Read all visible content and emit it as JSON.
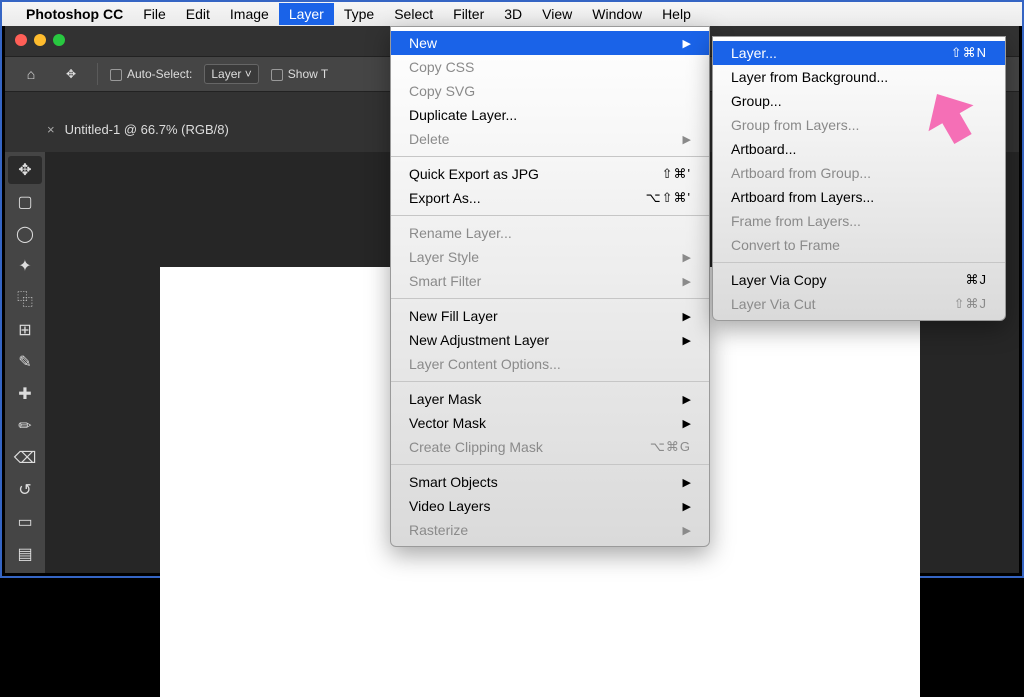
{
  "menubar": {
    "app": "Photoshop CC",
    "items": [
      "File",
      "Edit",
      "Image",
      "Layer",
      "Type",
      "Select",
      "Filter",
      "3D",
      "View",
      "Window",
      "Help"
    ],
    "active": "Layer"
  },
  "options_bar": {
    "auto_select_label": "Auto-Select:",
    "auto_select_value": "Layer",
    "show_label": "Show T"
  },
  "doc_tab": {
    "title": "Untitled-1 @ 66.7% (RGB/8)"
  },
  "layer_menu": [
    {
      "label": "New",
      "arrow": true,
      "hi": true
    },
    {
      "label": "Copy CSS",
      "disabled": true
    },
    {
      "label": "Copy SVG",
      "disabled": true
    },
    {
      "label": "Duplicate Layer..."
    },
    {
      "label": "Delete",
      "arrow": true,
      "disabled": true
    },
    {
      "sep": true
    },
    {
      "label": "Quick Export as JPG",
      "shortcut": "⇧⌘'"
    },
    {
      "label": "Export As...",
      "shortcut": "⌥⇧⌘'"
    },
    {
      "sep": true
    },
    {
      "label": "Rename Layer...",
      "disabled": true
    },
    {
      "label": "Layer Style",
      "arrow": true,
      "disabled": true
    },
    {
      "label": "Smart Filter",
      "arrow": true,
      "disabled": true
    },
    {
      "sep": true
    },
    {
      "label": "New Fill Layer",
      "arrow": true
    },
    {
      "label": "New Adjustment Layer",
      "arrow": true
    },
    {
      "label": "Layer Content Options...",
      "disabled": true
    },
    {
      "sep": true
    },
    {
      "label": "Layer Mask",
      "arrow": true
    },
    {
      "label": "Vector Mask",
      "arrow": true
    },
    {
      "label": "Create Clipping Mask",
      "shortcut": "⌥⌘G",
      "disabled": true
    },
    {
      "sep": true
    },
    {
      "label": "Smart Objects",
      "arrow": true
    },
    {
      "label": "Video Layers",
      "arrow": true
    },
    {
      "label": "Rasterize",
      "arrow": true,
      "disabled": true
    }
  ],
  "submenu": [
    {
      "label": "Layer...",
      "shortcut": "⇧⌘N",
      "hi": true
    },
    {
      "label": "Layer from Background..."
    },
    {
      "label": "Group..."
    },
    {
      "label": "Group from Layers...",
      "disabled": true
    },
    {
      "label": "Artboard..."
    },
    {
      "label": "Artboard from Group...",
      "disabled": true
    },
    {
      "label": "Artboard from Layers..."
    },
    {
      "label": "Frame from Layers...",
      "disabled": true
    },
    {
      "label": "Convert to Frame",
      "disabled": true
    },
    {
      "sep": true
    },
    {
      "label": "Layer Via Copy",
      "shortcut": "⌘J"
    },
    {
      "label": "Layer Via Cut",
      "shortcut": "⇧⌘J",
      "disabled": true
    }
  ],
  "tools": [
    "move",
    "marquee",
    "lasso",
    "wand",
    "crop",
    "frame",
    "eyedropper",
    "heal",
    "brush",
    "stamp",
    "history",
    "eraser",
    "gradient"
  ]
}
